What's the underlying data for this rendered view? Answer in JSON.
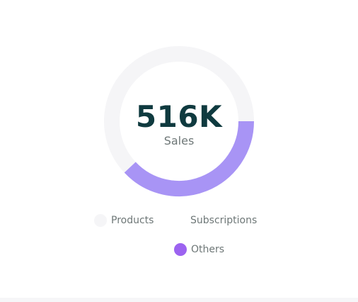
{
  "chart_data": {
    "type": "pie",
    "variant": "donut",
    "center": {
      "value": "516K",
      "label": "Sales"
    },
    "categories": [
      "Products",
      "Subscriptions",
      "Others"
    ],
    "values": [
      62,
      0,
      38
    ],
    "colors": [
      "#f5f5f7",
      "#ffffff",
      "#a894f5"
    ],
    "legend_dot_colors": [
      "#f5f5f7",
      "#ffffff",
      "#9c63f0"
    ],
    "legend_position": "bottom"
  }
}
